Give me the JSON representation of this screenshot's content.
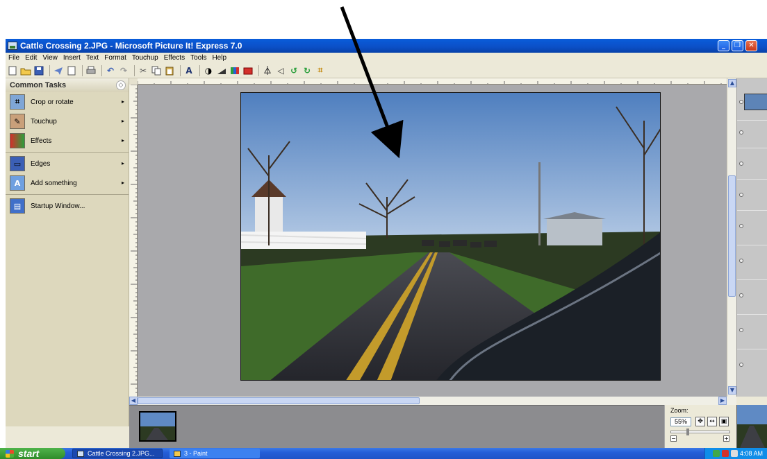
{
  "window": {
    "title": "Cattle Crossing 2.JPG - Microsoft Picture It! Express 7.0",
    "minimize_label": "_",
    "maximize_label": "❐",
    "close_label": "✕"
  },
  "menu": {
    "items": [
      "File",
      "Edit",
      "View",
      "Insert",
      "Text",
      "Format",
      "Touchup",
      "Effects",
      "Tools",
      "Help"
    ]
  },
  "task_pane": {
    "header": "Common Tasks",
    "collapse_label": "◇",
    "items": [
      {
        "label": "Crop or rotate",
        "icon": "crop-rotate-icon"
      },
      {
        "label": "Touchup",
        "icon": "touchup-icon"
      },
      {
        "label": "Effects",
        "icon": "effects-icon"
      },
      {
        "label": "Edges",
        "icon": "edges-icon"
      },
      {
        "label": "Add something",
        "icon": "add-something-icon"
      },
      {
        "label": "Startup Window...",
        "icon": "startup-window-icon"
      }
    ],
    "submenu_arrow": "▸"
  },
  "zoom": {
    "label": "Zoom:",
    "value": "55%"
  },
  "taskbar": {
    "start_label": "start",
    "apps": [
      "Cattle Crossing 2.JPG...",
      "3 - Paint"
    ],
    "clock": "4:08 AM"
  },
  "colors": {
    "title_bar": "#0b4fc6",
    "taskbar": "#245ed8",
    "task_pane": "#ddd8bd",
    "canvas": "#a9a9ac"
  }
}
